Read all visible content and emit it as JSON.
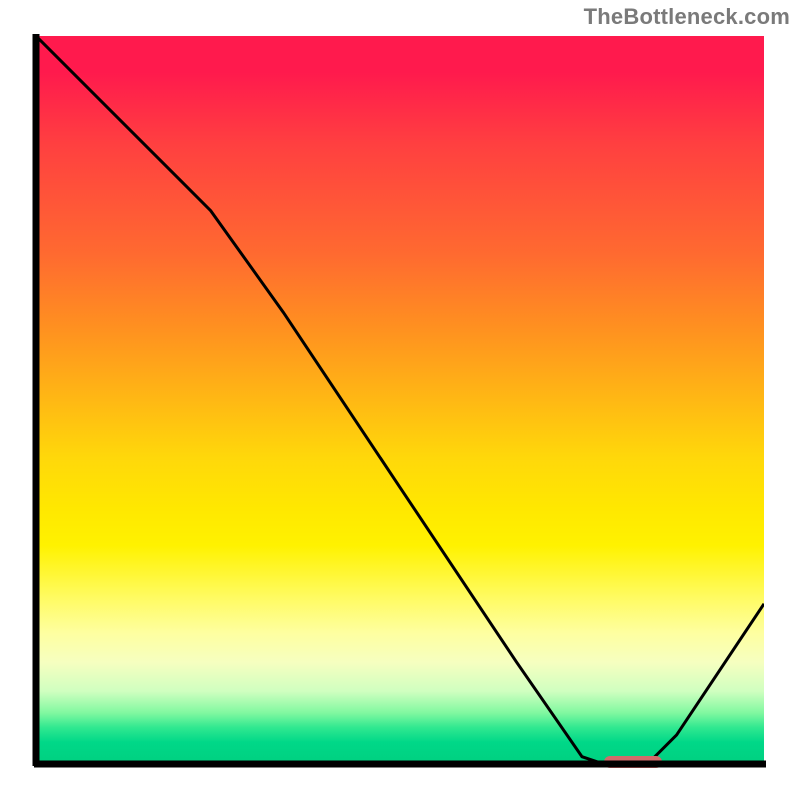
{
  "watermark": "TheBottleneck.com",
  "chart_data": {
    "type": "line",
    "title": "",
    "xlabel": "",
    "ylabel": "",
    "xlim": [
      0,
      100
    ],
    "ylim": [
      0,
      100
    ],
    "grid": false,
    "legend": false,
    "background_gradient": {
      "direction": "vertical",
      "stops": [
        {
          "pos": 0,
          "color": "#ff1a4d"
        },
        {
          "pos": 50,
          "color": "#ffb814"
        },
        {
          "pos": 70,
          "color": "#fff200"
        },
        {
          "pos": 90,
          "color": "#d0ffc0"
        },
        {
          "pos": 100,
          "color": "#00d080"
        }
      ]
    },
    "series": [
      {
        "name": "bottleneck-curve",
        "x": [
          0,
          10,
          20,
          24,
          34,
          50,
          66,
          75,
          78,
          84,
          88,
          100
        ],
        "y": [
          100,
          90,
          80,
          76,
          62,
          38,
          14,
          1,
          0,
          0,
          4,
          22
        ]
      }
    ],
    "marker": {
      "name": "optimal-range",
      "x_start": 78,
      "x_end": 86,
      "y": 0,
      "color": "#d36a6a"
    }
  }
}
